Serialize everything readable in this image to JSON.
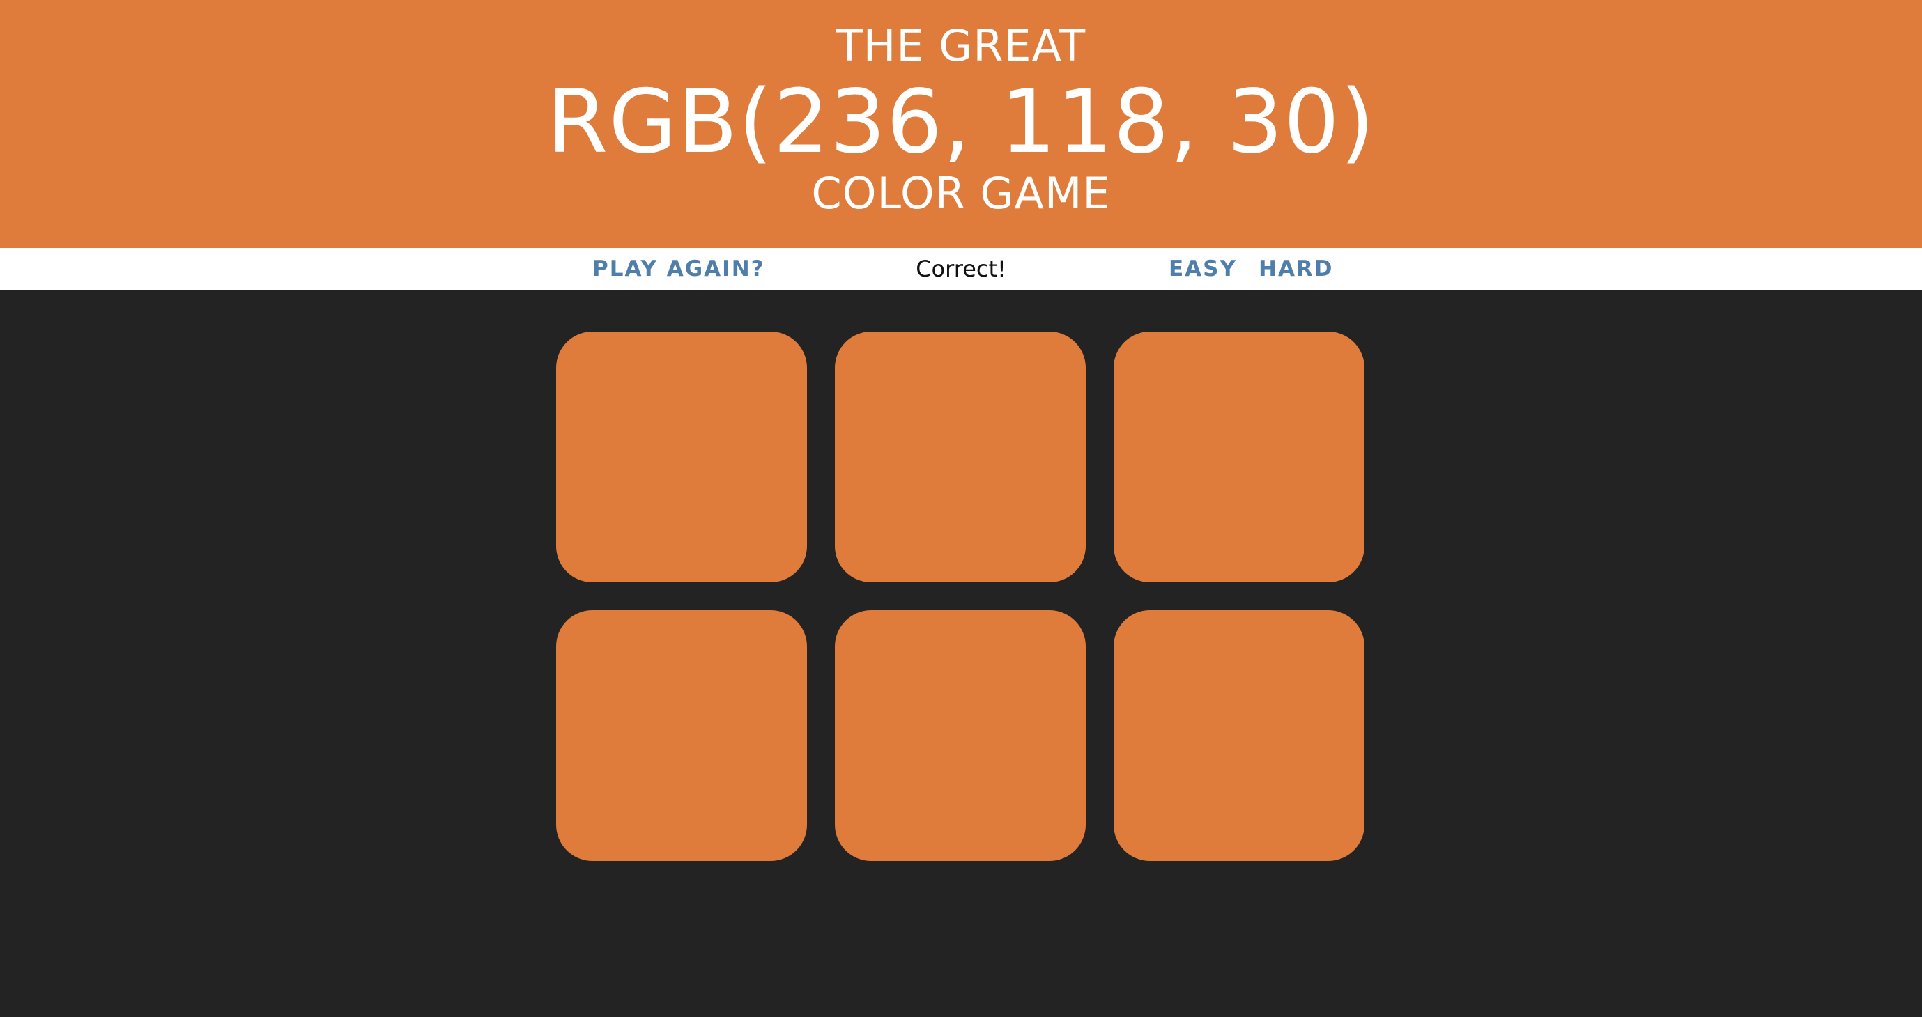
{
  "header": {
    "title_top": "THE GREAT",
    "target_color": "RGB(236, 118, 30)",
    "title_bottom": "COLOR GAME"
  },
  "controls": {
    "play_again_label": "PLAY AGAIN?",
    "message": "Correct!",
    "easy_label": "EASY",
    "hard_label": "HARD"
  },
  "squares": [
    {
      "color": "#df7c3b"
    },
    {
      "color": "#df7c3b"
    },
    {
      "color": "#df7c3b"
    },
    {
      "color": "#df7c3b"
    },
    {
      "color": "#df7c3b"
    },
    {
      "color": "#df7c3b"
    }
  ],
  "colors": {
    "header_background": "#df7c3b",
    "page_background": "#232323",
    "button_text": "#4e7ea9",
    "stripe_background": "#ffffff"
  }
}
